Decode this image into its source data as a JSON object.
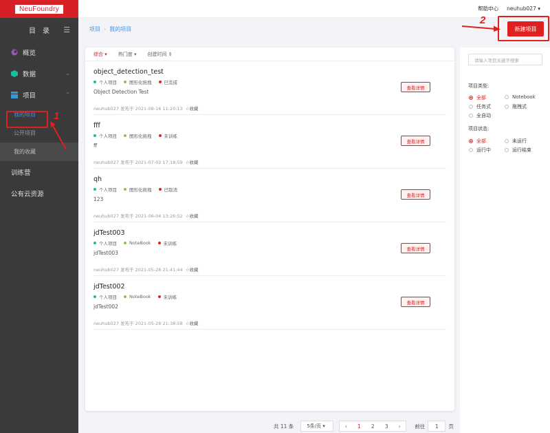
{
  "sidebar": {
    "logo": "NeuFoundry",
    "heading": "目　录",
    "menu_icon": "hamburger-icon",
    "items": [
      {
        "label": "概览",
        "icon": "overview-icon",
        "color": "#9b59b6"
      },
      {
        "label": "数据",
        "icon": "data-cube-icon",
        "color": "#1abc9c"
      },
      {
        "label": "项目",
        "icon": "project-icon",
        "color": "#3498db"
      }
    ],
    "subitems": [
      "我的项目",
      "公开项目",
      "我的收藏"
    ],
    "bottom_items": [
      "训练营",
      "公有云资源"
    ]
  },
  "annotations": {
    "n1": "1",
    "n2": "2"
  },
  "topbar": {
    "help": "帮助中心",
    "user": "neuhub027 ▾"
  },
  "breadcrumb": {
    "root": "项目",
    "sep": "›",
    "current": "我的项目"
  },
  "new_button": "新建项目",
  "sort": {
    "comprehensive": "综合 ▾",
    "hot": "热门度 ▾",
    "created": "创建时间 ⇕"
  },
  "projects": [
    {
      "title": "object_detection_test",
      "tags": [
        "个人项目",
        "图形化拖拽",
        "已完成"
      ],
      "desc": "Object Detection Test",
      "meta": "neuhub027 发布于 2021-08-16 11:20:13",
      "fav": "☆收藏",
      "detail": "查看详情"
    },
    {
      "title": "fff",
      "tags": [
        "个人项目",
        "图形化拖拽",
        "未训练"
      ],
      "desc": "ff",
      "meta": "neuhub027 发布于 2021-07-02 17:18:59",
      "fav": "☆收藏",
      "detail": "查看详情"
    },
    {
      "title": "qh",
      "tags": [
        "个人项目",
        "图形化拖拽",
        "已取消"
      ],
      "desc": "123",
      "meta": "neuhub027 发布于 2021-06-04 13:26:52",
      "fav": "☆收藏",
      "detail": "查看详情"
    },
    {
      "title": "jdTest003",
      "tags": [
        "个人项目",
        "NoteBook",
        "未训练"
      ],
      "desc": "jdTest003",
      "meta": "neuhub027 发布于 2021-05-28 21:41:44",
      "fav": "☆收藏",
      "detail": "查看详情"
    },
    {
      "title": "jdTest002",
      "tags": [
        "个人项目",
        "NoteBook",
        "未训练"
      ],
      "desc": "jdTest002",
      "meta": "neuhub027 发布于 2021-05-28 21:38:58",
      "fav": "☆收藏",
      "detail": "查看详情"
    }
  ],
  "tag_colors": [
    "#1abc9c",
    "#8bc34a",
    "#e02020"
  ],
  "pager": {
    "total": "共 11 条",
    "size": "5条/页 ▾",
    "prev": "‹",
    "pages": [
      "1",
      "2",
      "3"
    ],
    "next": "›",
    "goto": "前往",
    "page_value": "1",
    "page_unit": "页"
  },
  "filter": {
    "search_placeholder": "请输入项目关键字搜索",
    "type_label": "项目类型:",
    "types": [
      "全部",
      "Notebook",
      "任务式",
      "拖拽式",
      "全自动"
    ],
    "status_label": "项目状态:",
    "statuses": [
      "全部",
      "未运行",
      "运行中",
      "运行结束"
    ]
  }
}
